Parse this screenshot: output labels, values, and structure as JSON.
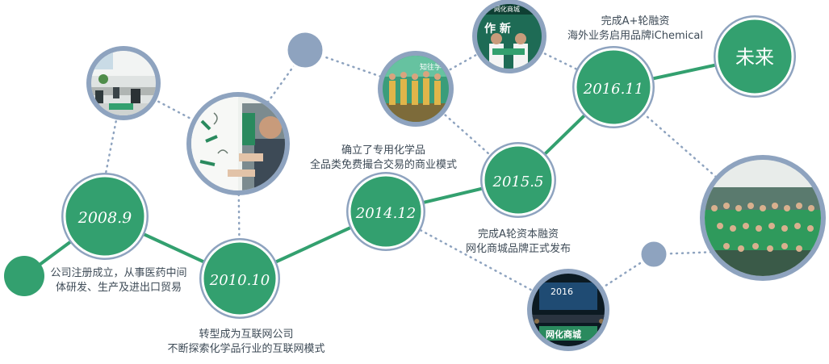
{
  "colors": {
    "primary": "#33a06f",
    "primary_dark": "#2a8a5e",
    "gray_node": "#8ea3bf",
    "ring": "#ffffff",
    "text": "#3d4a56"
  },
  "milestones": [
    {
      "year": "2008.9",
      "caption": [
        "公司注册成立，从事医药中间",
        "体研发、生产及进出口贸易"
      ]
    },
    {
      "year": "2010.10",
      "caption": [
        "转型成为互联网公司",
        "不断探索化学品行业的互联网模式"
      ]
    },
    {
      "year": "2014.12",
      "caption": [
        "确立了专用化学品",
        "全品类免费撮合交易的商业模式"
      ]
    },
    {
      "year": "2015.5",
      "caption": [
        "完成A轮资本融资",
        "网化商城品牌正式发布"
      ]
    },
    {
      "year": "2016.11",
      "caption": [
        "完成A+轮融资",
        "海外业务启用品牌iChemical"
      ]
    },
    {
      "year": "未来",
      "caption": []
    }
  ],
  "photos": {
    "office": "office-photo",
    "whiteboard": "whiteboard-signing-photo",
    "dancers": "stage-performers-photo",
    "signing": "signing-ceremony-photo",
    "team": "team-group-photo",
    "launch": "launch-event-photo",
    "dancers_sign": "知往学",
    "signing_sign": "网化商城",
    "signing_banner": "作 新",
    "launch_screen": "2016",
    "launch_logo": "网化商城"
  }
}
